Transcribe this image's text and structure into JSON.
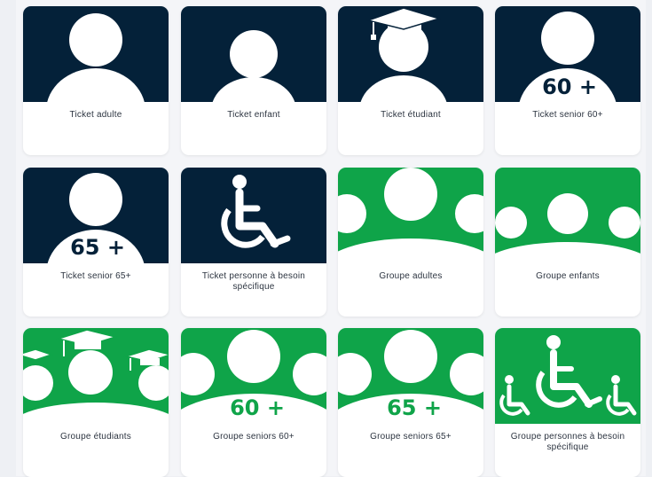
{
  "colors": {
    "navy": "#042139",
    "green": "#0fa449",
    "white": "#ffffff",
    "page_bg": "#eef0f4"
  },
  "cards": [
    {
      "label": "Ticket adulte",
      "icon": "adult-person-icon"
    },
    {
      "label": "Ticket enfant",
      "icon": "child-person-icon"
    },
    {
      "label": "Ticket étudiant",
      "icon": "student-graduation-cap-icon"
    },
    {
      "label": "Ticket senior 60+",
      "icon": "senior-60-icon",
      "badge": "60 +"
    },
    {
      "label": "Ticket senior 65+",
      "icon": "senior-65-icon",
      "badge": "65 +"
    },
    {
      "label": "Ticket personne à besoin spécifique",
      "icon": "wheelchair-icon"
    },
    {
      "label": "Groupe adultes",
      "icon": "group-adults-icon"
    },
    {
      "label": "Groupe enfants",
      "icon": "group-children-icon"
    },
    {
      "label": "Groupe étudiants",
      "icon": "group-students-icon"
    },
    {
      "label": "Groupe seniors 60+",
      "icon": "group-seniors-60-icon",
      "badge": "60 +"
    },
    {
      "label": "Groupe seniors 65+",
      "icon": "group-seniors-65-icon",
      "badge": "65 +"
    },
    {
      "label": "Groupe personnes à besoin spécifique",
      "icon": "group-wheelchair-icon"
    }
  ]
}
